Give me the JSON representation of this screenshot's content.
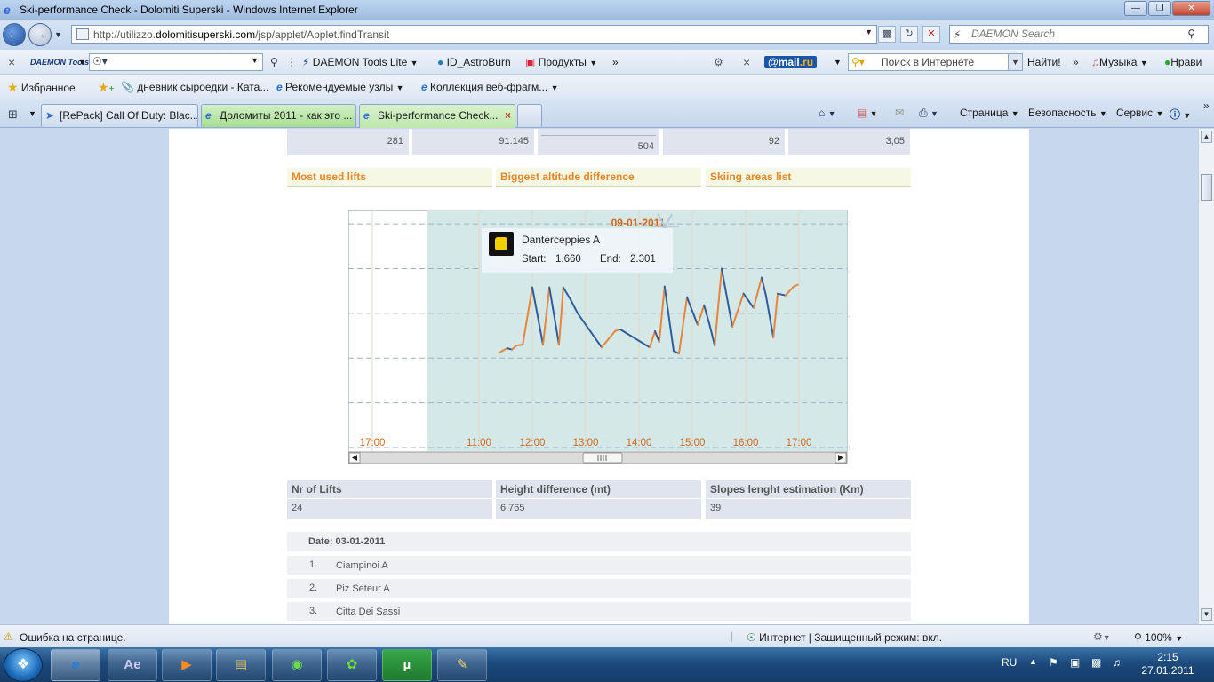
{
  "window": {
    "title": "Ski-performance Check - Dolomiti Superski - Windows Internet Explorer"
  },
  "address": {
    "url_prefix": "http://utilizzo.",
    "url_domain": "dolomitisuperski.com",
    "url_suffix": "/jsp/applet/Applet.findTransit",
    "search_placeholder": "DAEMON Search"
  },
  "toolbar": {
    "daemon_logo": "DAEMON Tools",
    "daemon_lite": "DAEMON Tools Lite",
    "astroburn": "ID_AstroBurn",
    "products": "Продукты",
    "mail_badge_main": "@mail",
    "mail_badge_suffix": ".ru",
    "search_placeholder": "Поиск в Интернете",
    "find_button": "Найти!",
    "music": "Музыка",
    "likes": "Нрави"
  },
  "favorites": {
    "label": "Избранное",
    "items": [
      {
        "label": "дневник сыроедки - Ката..."
      },
      {
        "label": "Рекомендуемые узлы"
      },
      {
        "label": "Коллекция веб-фрагм..."
      }
    ]
  },
  "tabs": [
    {
      "label": "[RePack] Call Of Duty: Blac..."
    },
    {
      "label": "Доломиты 2011 - как это ..."
    },
    {
      "label": "Ski-performance Check..."
    }
  ],
  "commandbar": {
    "page": "Страница",
    "safety": "Безопасность",
    "service": "Сервис"
  },
  "stats_top": [
    "281",
    "91.145",
    "504",
    "92",
    "3,05"
  ],
  "links": [
    "Most used lifts",
    "Biggest altitude difference",
    "Skiing areas list"
  ],
  "chart_data": {
    "type": "line",
    "date_label": "09-01-2011",
    "y_ticks": [
      500,
      1000,
      1500,
      2000,
      2500,
      3000
    ],
    "ylim": [
      450,
      3150
    ],
    "x_ticks": [
      "17:00",
      "11:00",
      "12:00",
      "13:00",
      "14:00",
      "15:00",
      "16:00",
      "17:00"
    ],
    "grid": true,
    "tooltip": {
      "lift_name": "Danterceppies A",
      "start_label": "Start:",
      "start_value": "1.660",
      "end_label": "End:",
      "end_value": "2.301"
    },
    "series": [
      {
        "x": [
          11.38,
          11.45,
          11.53,
          11.62,
          11.7,
          11.82,
          12.0,
          12.2,
          12.32,
          12.5,
          12.58,
          12.72,
          12.85,
          13.3,
          13.55,
          13.65,
          14.2,
          14.3,
          14.38,
          14.48,
          14.65,
          14.75,
          14.9,
          15.1,
          15.22,
          15.32,
          15.42,
          15.55,
          15.75,
          15.96,
          16.15,
          16.3,
          16.38,
          16.52,
          16.6,
          16.75,
          16.9,
          16.98
        ],
        "y": [
          1560,
          1585,
          1610,
          1595,
          1640,
          1650,
          2290,
          1650,
          2290,
          1650,
          2290,
          2150,
          2000,
          1620,
          1800,
          1820,
          1620,
          1800,
          1680,
          2300,
          1580,
          1550,
          2180,
          1870,
          2090,
          1880,
          1640,
          2500,
          1850,
          2220,
          2060,
          2400,
          2200,
          1730,
          2220,
          2200,
          2300,
          2320
        ]
      }
    ],
    "colors": {
      "up": "#e8853a",
      "down": "#2e5d9c",
      "plot_bg": "#d5e8e8",
      "axis_text": "#3d6aa8",
      "time_text": "#d2691e"
    }
  },
  "summary": [
    {
      "header": "Nr of Lifts",
      "value": "24"
    },
    {
      "header": "Height difference (mt)",
      "value": "6.765"
    },
    {
      "header": "Slopes lenght estimation (Km)",
      "value": "39"
    }
  ],
  "date_heading": "Date: 03-01-2011",
  "lifts": [
    {
      "num": "1.",
      "name": "Ciampinoi A"
    },
    {
      "num": "2.",
      "name": "Piz Seteur A"
    },
    {
      "num": "3.",
      "name": "Citta Dei Sassi"
    }
  ],
  "status": {
    "error": "Ошибка на странице.",
    "zone": "Интернет | Защищенный режим: вкл.",
    "zoom": "100%"
  },
  "taskbar": {
    "lang": "RU",
    "time": "2:15",
    "date": "27.01.2011"
  }
}
